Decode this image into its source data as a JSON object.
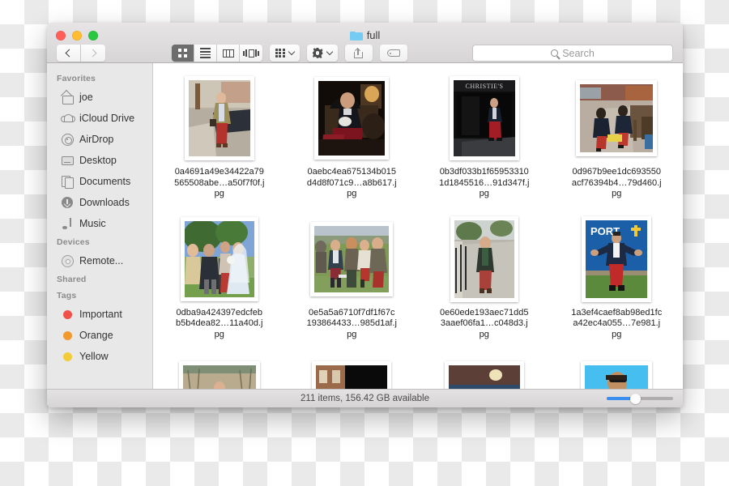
{
  "window": {
    "title": "full",
    "folder_icon": "folder-icon",
    "traffic_lights": [
      "close-red",
      "minimize-yellow",
      "zoom-green"
    ]
  },
  "toolbar": {
    "back_icon": "chevron-left-icon",
    "forward_icon": "chevron-right-icon",
    "views": [
      {
        "name": "icon-view",
        "icon": "grid-icon",
        "active": true
      },
      {
        "name": "list-view",
        "icon": "list-icon",
        "active": false
      },
      {
        "name": "column-view",
        "icon": "columns-icon",
        "active": false
      },
      {
        "name": "gallery-view",
        "icon": "gallery-icon",
        "active": false
      }
    ],
    "arrange_icon": "arrange-grid-icon",
    "action_icon": "gear-icon",
    "share_icon": "share-icon",
    "tag_icon": "tag-icon"
  },
  "search": {
    "icon": "search-icon",
    "placeholder": "Search",
    "value": ""
  },
  "sidebar": {
    "sections": [
      {
        "header": "Favorites",
        "items": [
          {
            "label": "joe",
            "icon": "home-icon"
          },
          {
            "label": "iCloud Drive",
            "icon": "cloud-icon"
          },
          {
            "label": "AirDrop",
            "icon": "airdrop-icon"
          },
          {
            "label": "Desktop",
            "icon": "desktop-icon"
          },
          {
            "label": "Documents",
            "icon": "documents-icon"
          },
          {
            "label": "Downloads",
            "icon": "downloads-icon"
          },
          {
            "label": "Music",
            "icon": "music-icon"
          }
        ]
      },
      {
        "header": "Devices",
        "items": [
          {
            "label": "Remote...",
            "icon": "disc-icon"
          }
        ]
      },
      {
        "header": "Shared",
        "items": []
      },
      {
        "header": "Tags",
        "items": [
          {
            "label": "Important",
            "icon": "tag-dot-icon",
            "color": "#f05047"
          },
          {
            "label": "Orange",
            "icon": "tag-dot-icon",
            "color": "#f2992e"
          },
          {
            "label": "Yellow",
            "icon": "tag-dot-icon",
            "color": "#f2cb3a"
          }
        ]
      }
    ]
  },
  "files": [
    {
      "name": "0a4691a49e34422a79565508abe…a50f7f0f.jpg",
      "thumb": "street-parked-cars-man-red-trousers"
    },
    {
      "name": "0aebc4ea675134b015d4d8f071c9…a8b617.jpg",
      "thumb": "dark-interior-seated-man-red-trousers"
    },
    {
      "name": "0b3df033b1f659533101d1845516…91d347f.jpg",
      "thumb": "christies-storefront-man-walking"
    },
    {
      "name": "0d967b9ee1dc693550acf76394b4…79d460.jpg",
      "thumb": "market-street-two-people-navy-red"
    },
    {
      "name": "0dba9a424397edcfebb5b4dea82…11a40d.jpg",
      "thumb": "wedding-group-bride-outdoors"
    },
    {
      "name": "0e5a5a6710f7df1f67c193864433…985d1af.jpg",
      "thumb": "group-standing-on-grass-field"
    },
    {
      "name": "0e60ede193aec71dd53aaef06fa1…c048d3.jpg",
      "thumb": "man-by-iron-railing-pavement"
    },
    {
      "name": "1a3ef4caef8ab98ed1fca42ec4a055…7e981.jpg",
      "thumb": "man-blue-backdrop-port-sign"
    },
    {
      "name": "",
      "thumb": "field-bare-trees-man"
    },
    {
      "name": "",
      "thumb": "dark-brick-building-night"
    },
    {
      "name": "",
      "thumb": "indoor-venue-crowd"
    },
    {
      "name": "",
      "thumb": "man-blue-sky-sunglasses"
    }
  ],
  "status": {
    "text": "211 items, 156.42 GB available",
    "zoom_slider": {
      "value": 42,
      "accent": "#3a8ef0"
    }
  }
}
